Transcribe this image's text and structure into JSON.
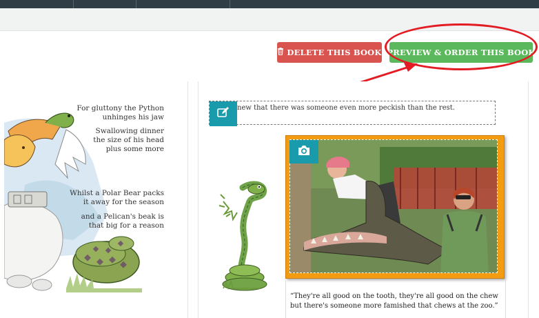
{
  "toolbar": {
    "delete_label": "DELETE THIS BOOK",
    "preview_label": "PREVIEW & ORDER THIS BOOK",
    "delete_icon": "trash-icon",
    "delete_color": "#d9534f",
    "preview_color": "#5cb85c"
  },
  "annotation": {
    "color": "#e31b23"
  },
  "left_page": {
    "stanza1": "For gluttony the Python unhinges his jaw",
    "stanza2": "Swallowing dinner the size of his head plus some more",
    "stanza3": "Whilst a Polar Bear packs it away for the season",
    "stanza4": "and a Pelican's beak is that big for a reason",
    "lines": [
      "For gluttony the Python",
      "unhinges his jaw",
      "Swallowing dinner",
      "the size of his head",
      "plus some more",
      "Whilst a Polar Bear packs",
      "it away for the season",
      "and a Pelican's beak is",
      "that big for a reason"
    ]
  },
  "right_page": {
    "text_box": "new that there was someone even more peckish than the rest.",
    "edit_icon": "edit-icon",
    "camera_icon": "camera-icon",
    "caption_line1": "“They're all good on the tooth, they're all good on the chew",
    "caption_line2": "but there's someone more famished that chews at the zoo.”"
  }
}
